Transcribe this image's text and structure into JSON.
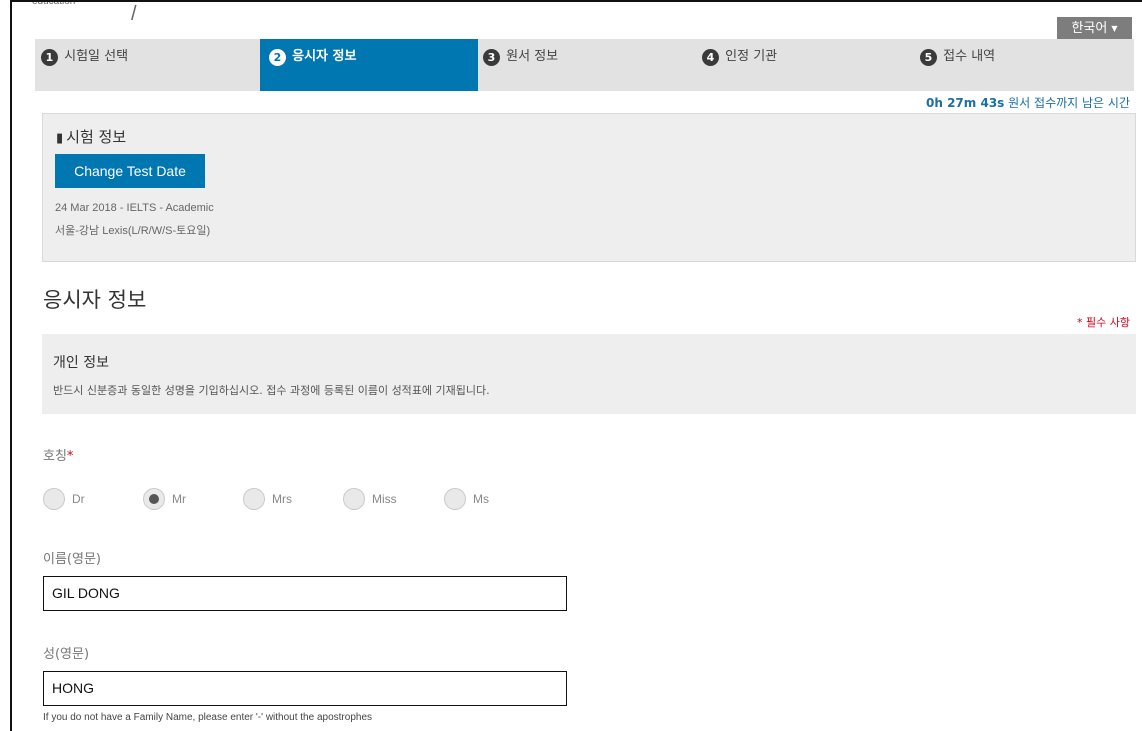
{
  "header": {
    "logo_fragment": "education",
    "logo_slash": "/",
    "language": {
      "label": "한국어",
      "caret_icon": "caret-down-icon"
    }
  },
  "steps": [
    {
      "number": "1",
      "label": "시험일 선택",
      "active": false
    },
    {
      "number": "2",
      "label": "응시자 정보",
      "active": true
    },
    {
      "number": "3",
      "label": "원서 정보",
      "active": false
    },
    {
      "number": "4",
      "label": "인정 기관",
      "active": false
    },
    {
      "number": "5",
      "label": "접수 내역",
      "active": false
    }
  ],
  "timer": {
    "time": "0h 27m 43s",
    "text": "원서 접수까지 남은 시간"
  },
  "test_info": {
    "icon": "book-icon",
    "title": "시험 정보",
    "change_button": "Change Test Date",
    "line1": "24 Mar 2018 - IELTS - Academic",
    "line2": "서울-강남 Lexis(L/R/W/S-토요일)"
  },
  "section": {
    "title": "응시자 정보",
    "required_note": "* 필수 사항"
  },
  "personal": {
    "title": "개인 정보",
    "description": "반드시 신분증과 동일한 성명을 기입하십시오. 접수 과정에 등록된 이름이 성적표에 기재됩니다."
  },
  "form": {
    "title_label": "호칭",
    "required_mark": "*",
    "titles": [
      {
        "label": "Dr",
        "checked": false
      },
      {
        "label": "Mr",
        "checked": true
      },
      {
        "label": "Mrs",
        "checked": false
      },
      {
        "label": "Miss",
        "checked": false
      },
      {
        "label": "Ms",
        "checked": false
      }
    ],
    "first_name_label": "이름(영문)",
    "first_name_value": "GIL DONG",
    "last_name_label": "성(영문)",
    "last_name_value": "HONG",
    "last_name_hint": "If you do not have a Family Name, please enter '-' without the apostrophes"
  }
}
